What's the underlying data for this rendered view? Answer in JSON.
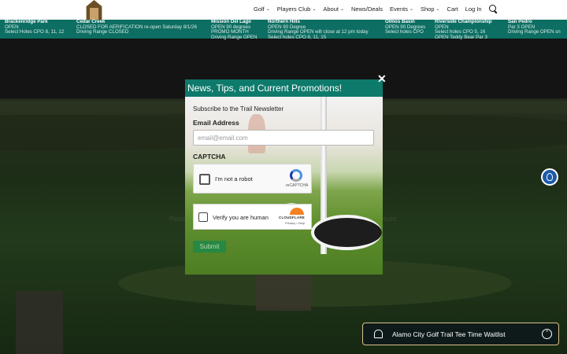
{
  "nav": {
    "items": [
      {
        "label": "Golf",
        "has_caret": true
      },
      {
        "label": "Players Club",
        "has_caret": true
      },
      {
        "label": "About",
        "has_caret": true
      },
      {
        "label": "News/Deals",
        "has_caret": false
      },
      {
        "label": "Events",
        "has_caret": true
      },
      {
        "label": "Shop",
        "has_caret": true
      },
      {
        "label": "Cart",
        "has_caret": false
      },
      {
        "label": "Log In",
        "has_caret": false
      }
    ],
    "caret_glyph": "⌄",
    "search_icon": "search-icon"
  },
  "status": {
    "courses": [
      {
        "name": "Brackenridge Park",
        "lines": [
          "OPEN",
          "Select Holes CPO 8, 11, 12"
        ]
      },
      {
        "name": "Cedar Creek",
        "lines": [
          "CLOSED FOR AERIFICATION re-open Saturday 8/1/26",
          "Driving Range CLOSED"
        ]
      },
      {
        "name": "Mission Del Lago",
        "lines": [
          "OPEN 90 degrees",
          "PROMO MONTH",
          "Driving Range OPEN"
        ]
      },
      {
        "name": "Northern Hills",
        "lines": [
          "OPEN 90 Degree",
          "Driving Range OPEN will close at 12 pm today",
          "Select holes CPO 8, 11, 15"
        ]
      },
      {
        "name": "Olmos Basin",
        "lines": [
          "OPEN 90 Degrees",
          "Select holes CPO"
        ]
      },
      {
        "name": "Riverside Championship",
        "lines": [
          "OPEN",
          "Select holes CPO 5, 16",
          "OPEN Teddy Bear Par 3"
        ]
      },
      {
        "name": "San Pedro",
        "lines": [
          "Par 3 OPEN",
          "Driving Range OPEN sn"
        ]
      }
    ]
  },
  "modal": {
    "title": "News, Tips, and Current Promotions!",
    "close_glyph": "✕",
    "subscribe_text": "Subscribe to the Trail Newsletter",
    "email_label": "Email Address",
    "email_placeholder": "email@email.com",
    "email_value": "",
    "captcha_label": "CAPTCHA",
    "recaptcha_label": "I'm not a robot",
    "recaptcha_brand": "reCAPTCHA",
    "turnstile_label": "Verify you are human",
    "turnstile_brand": "CLOUDFLARE",
    "turnstile_links": "Privacy • Help",
    "submit_label": "Submit"
  },
  "background": {
    "ghost_left": "Rese",
    "ghost_right": "vices"
  },
  "waitlist": {
    "label": "Alamo City Golf Trail Tee Time Waitlist",
    "chevron_glyph": "⌃"
  },
  "colors": {
    "header_bg": "#ffffff",
    "status_bg": "#0d6e63",
    "modal_head": "#0d7a6b",
    "submit_bg": "#1a8a4a",
    "waitlist_border": "#d8c28a"
  }
}
